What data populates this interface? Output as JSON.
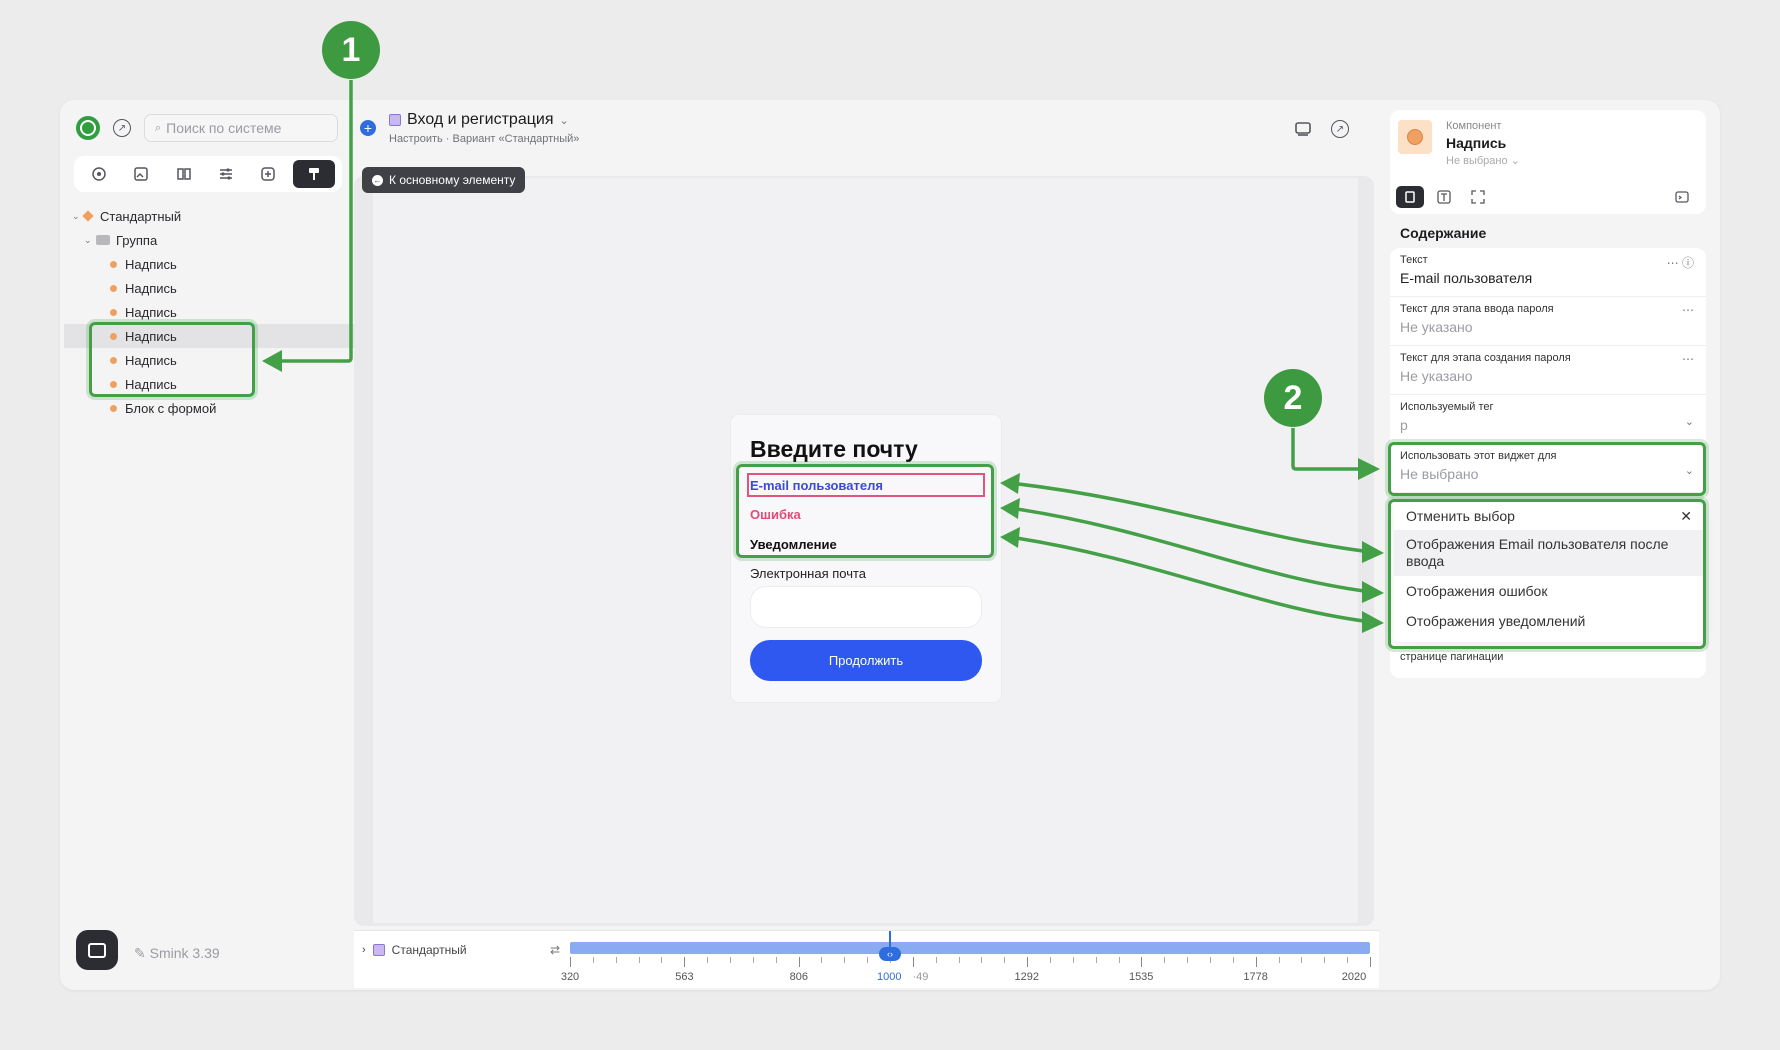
{
  "sidebar": {
    "search_placeholder": "Поиск по системе",
    "tree": [
      {
        "label": "Стандартный",
        "kind": "variant",
        "level": 0
      },
      {
        "label": "Группа",
        "kind": "folder",
        "level": 1
      },
      {
        "label": "Надпись",
        "kind": "item",
        "level": 2
      },
      {
        "label": "Надпись",
        "kind": "item",
        "level": 2
      },
      {
        "label": "Надпись",
        "kind": "item",
        "level": 2
      },
      {
        "label": "Надпись",
        "kind": "item",
        "level": 2,
        "selected": true
      },
      {
        "label": "Надпись",
        "kind": "item",
        "level": 2
      },
      {
        "label": "Надпись",
        "kind": "item",
        "level": 2
      },
      {
        "label": "Блок с формой",
        "kind": "item",
        "level": 2
      }
    ],
    "version": "Smink 3.39"
  },
  "header": {
    "title": "Вход и регистрация",
    "subtitle": "Настроить · Вариант «Стандартный»",
    "back_label": "К основному элементу"
  },
  "preview": {
    "heading": "Введите почту",
    "email_label": "E-mail пользователя",
    "error_label": "Ошибка",
    "notice_label": "Уведомление",
    "field_label": "Электронная почта",
    "button_label": "Продолжить"
  },
  "breakpoints": {
    "variant_label": "Стандартный",
    "ticks": [
      "320",
      "563",
      "806",
      "1000",
      "1292",
      "1535",
      "1778",
      "2020"
    ],
    "partial_tick": "·49",
    "current": "1000"
  },
  "inspector": {
    "component_tag": "Компонент",
    "component_name": "Надпись",
    "component_select": "Не выбрано",
    "section": "Содержание",
    "props": [
      {
        "label": "Текст",
        "value": "E-mail пользователя",
        "muted": false
      },
      {
        "label": "Текст для этапа ввода пароля",
        "value": "Не указано",
        "muted": true
      },
      {
        "label": "Текст для этапа создания пароля",
        "value": "Не указано",
        "muted": true
      },
      {
        "label": "Используемый тег",
        "value": "p",
        "muted": true
      },
      {
        "label": "Использовать этот виджет для",
        "value": "Не выбрано",
        "muted": true
      }
    ],
    "dropdown": [
      "Отменить выбор",
      "Отображения Email пользователя после ввода",
      "Отображения ошибок",
      "Отображения уведомлений"
    ],
    "pagination_fragment": "странице пагинации"
  },
  "annotations": {
    "callout_1": "1",
    "callout_2": "2",
    "color": "#44a047"
  },
  "colors": {
    "accent": "#2f58f0",
    "error": "#e24a77",
    "email_label": "#3a4bd8"
  }
}
